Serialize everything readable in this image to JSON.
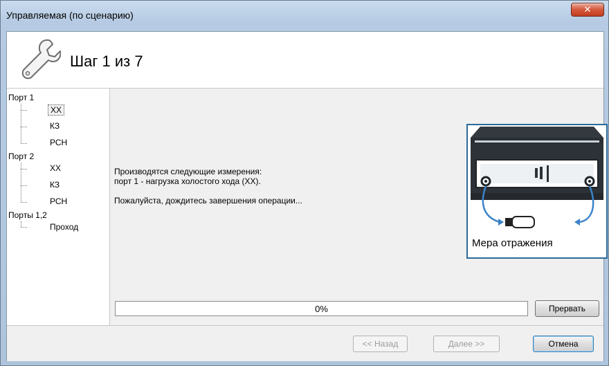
{
  "window": {
    "title": "Управляемая (по сценарию)",
    "close_glyph": "✕"
  },
  "header": {
    "step_title": "Шаг 1 из 7",
    "icon": "wrench-icon"
  },
  "tree": {
    "groups": [
      {
        "label": "Порт 1",
        "items": [
          "ХХ",
          "КЗ",
          "РСН"
        ]
      },
      {
        "label": "Порт 2",
        "items": [
          "ХХ",
          "КЗ",
          "РСН"
        ]
      },
      {
        "label": "Порты 1,2",
        "items": [
          "Проход"
        ]
      }
    ],
    "selected": "ХХ"
  },
  "main": {
    "line1": "Производятся следующие измерения:",
    "line2": "порт 1 - нагрузка холостого хода (ХХ).",
    "line3": "Пожалуйста, дождитесь завершения операции...",
    "figure_label": "Мера отражения",
    "progress": {
      "value": 0,
      "text": "0%"
    },
    "abort_label": "Прервать"
  },
  "footer": {
    "back_label": "<< Назад",
    "next_label": "Далее >>",
    "cancel_label": "Отмена"
  },
  "colors": {
    "accent": "#2a6a9a",
    "progress": "#3a9a3a",
    "close": "#c23d1e"
  }
}
